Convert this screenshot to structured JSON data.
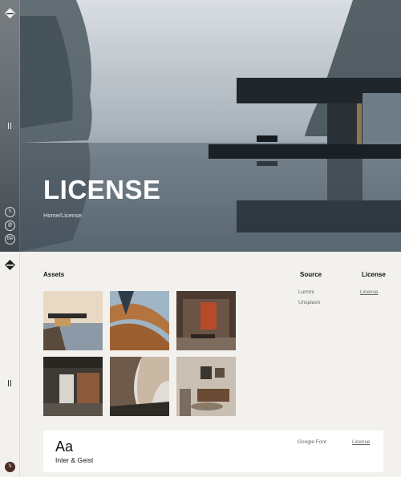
{
  "hero": {
    "title": "LICENSE",
    "breadcrumb_home": "Home",
    "breadcrumb_sep": "/",
    "breadcrumb_current": "License"
  },
  "social": {
    "x": "𝕏",
    "threads": "@",
    "behance": "Bē"
  },
  "assets": {
    "heading": "Assets",
    "source_heading": "Source",
    "license_heading": "License",
    "sources": [
      "Lummi",
      "Unsplash"
    ],
    "license_link": "License"
  },
  "fonts": {
    "sample": "Aa",
    "name": "Inter & Geist",
    "source": "Google Font",
    "license_link": "License"
  },
  "colors": {
    "page_bg": "#f3f1ee",
    "hero_text": "#ffffff",
    "badge": "#4a2c22"
  }
}
